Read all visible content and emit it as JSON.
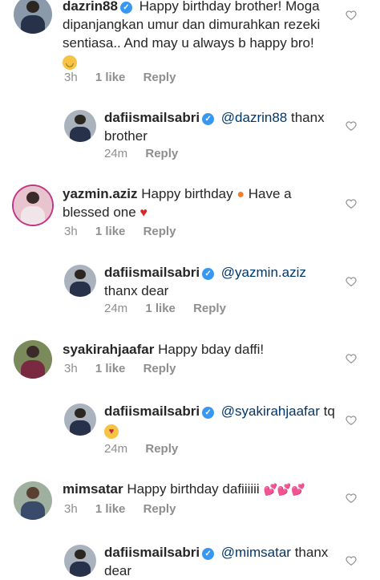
{
  "colors": {
    "link": "#00376b",
    "verified": "#3897f0",
    "muted": "#8e8e8e"
  },
  "comments": [
    {
      "username": "dazrin88",
      "verified": true,
      "text": "Happy birthday brother! Moga dipanjangkan umur dan dimurahkan rezeki sentiasa.. And may u always b happy bro!",
      "emoji": "smiling-face-emoji",
      "time": "3h",
      "likes": "1 like",
      "reply": "Reply"
    },
    {
      "username": "dafiismailsabri",
      "verified": true,
      "mention": "@dazrin88",
      "text": "thanx brother",
      "time": "24m",
      "reply": "Reply"
    },
    {
      "username": "yazmin.aziz",
      "text_a": "Happy birthday",
      "text_b": "Have a blessed one",
      "time": "3h",
      "likes": "1 like",
      "reply": "Reply"
    },
    {
      "username": "dafiismailsabri",
      "verified": true,
      "mention": "@yazmin.aziz",
      "text": "thanx dear",
      "time": "24m",
      "likes": "1 like",
      "reply": "Reply"
    },
    {
      "username": "syakirahjaafar",
      "text": "Happy bday daffi!",
      "time": "3h",
      "likes": "1 like",
      "reply": "Reply"
    },
    {
      "username": "dafiismailsabri",
      "verified": true,
      "mention": "@syakirahjaafar",
      "text": "tq",
      "time": "24m",
      "reply": "Reply"
    },
    {
      "username": "mimsatar",
      "text": "Happy birthday dafiiiiii",
      "time": "3h",
      "likes": "1 like",
      "reply": "Reply"
    },
    {
      "username": "dafiismailsabri",
      "verified": true,
      "mention": "@mimsatar",
      "text": "thanx dear"
    }
  ]
}
